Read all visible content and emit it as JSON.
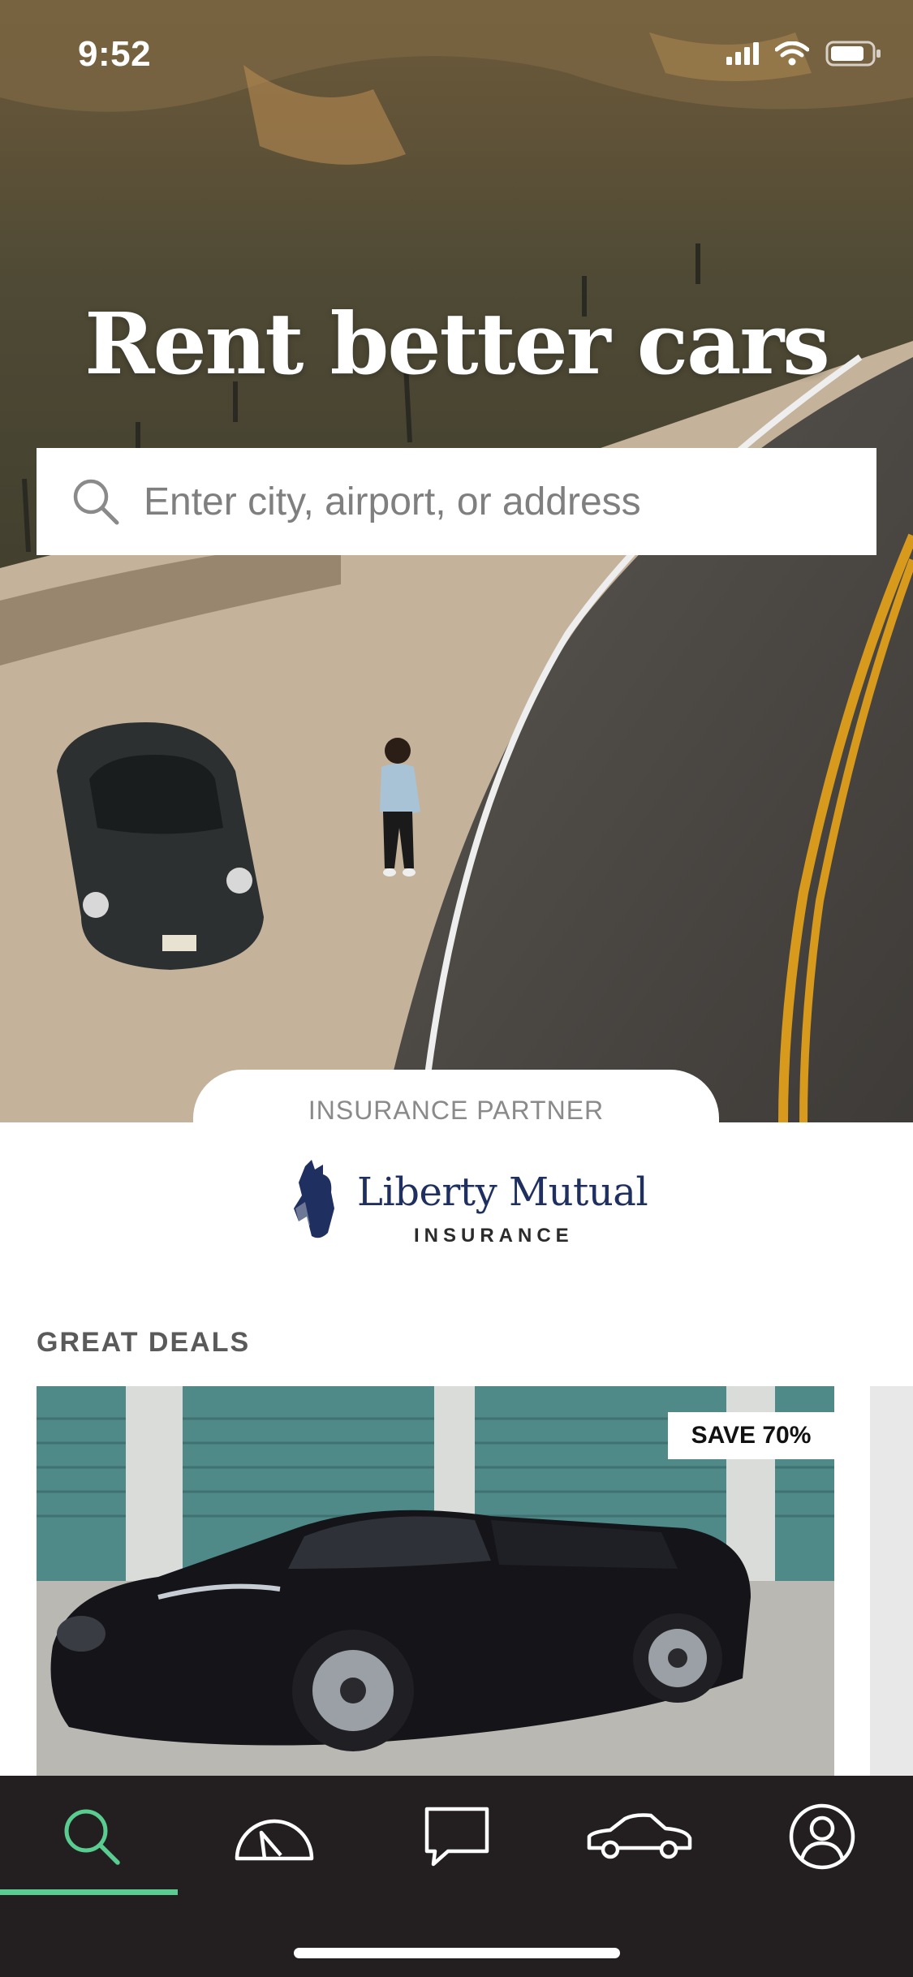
{
  "status_bar": {
    "time": "9:52",
    "icons": [
      "cellular-signal-icon",
      "wifi-icon",
      "battery-icon"
    ]
  },
  "hero": {
    "title": "Rent better cars",
    "search": {
      "placeholder": "Enter city, airport, or address",
      "value": "",
      "icon": "search-icon"
    }
  },
  "insurance_partner": {
    "label": "INSURANCE PARTNER",
    "logo_name": "Liberty Mutual",
    "logo_subtitle": "INSURANCE"
  },
  "deals": {
    "title": "GREAT DEALS",
    "cards": [
      {
        "badge": "SAVE 70%"
      }
    ]
  },
  "tab_bar": {
    "active": "search",
    "active_color": "#59cd8f",
    "tabs": [
      {
        "id": "search",
        "icon": "search-icon"
      },
      {
        "id": "trips",
        "icon": "speedometer-icon"
      },
      {
        "id": "messages",
        "icon": "chat-bubble-icon"
      },
      {
        "id": "host",
        "icon": "car-icon"
      },
      {
        "id": "account",
        "icon": "profile-icon"
      }
    ]
  }
}
